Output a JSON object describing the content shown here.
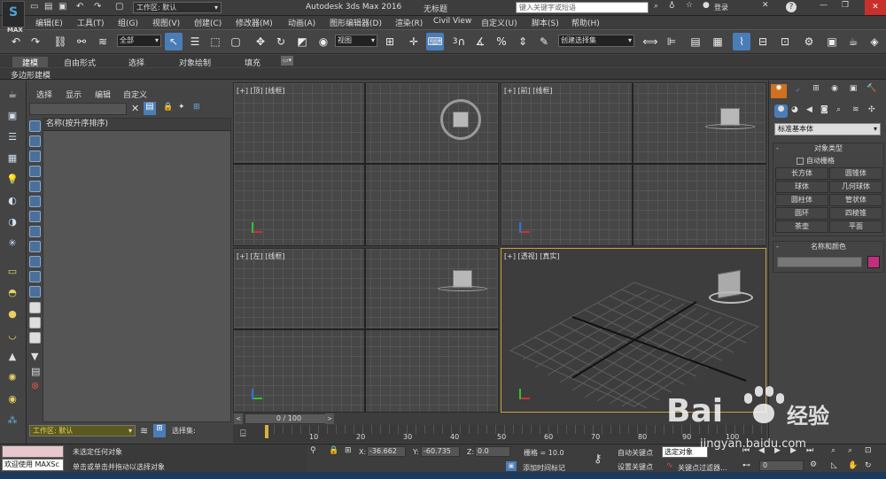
{
  "titlebar": {
    "logo": "MAX",
    "workspace_label": "工作区: 默认",
    "app_title": "Autodesk 3ds Max 2016",
    "doc_title": "无标题",
    "search_placeholder": "键入关键字或短语",
    "login_label": "登录"
  },
  "menubar": {
    "items": [
      "编辑(E)",
      "工具(T)",
      "组(G)",
      "视图(V)",
      "创建(C)",
      "修改器(M)",
      "动画(A)",
      "图形编辑器(D)",
      "渲染(R)",
      "Civil View",
      "自定义(U)",
      "脚本(S)",
      "帮助(H)"
    ]
  },
  "maintoolbar": {
    "selection_filter": "全部",
    "ref_coord": "视图",
    "named_selection": "创建选择集",
    "snap_label": "3"
  },
  "ribbon": {
    "tabs": [
      "建模",
      "自由形式",
      "选择",
      "对象绘制",
      "填充"
    ],
    "sub_label": "多边形建模"
  },
  "scene_explorer": {
    "menu": [
      "选择",
      "显示",
      "编辑",
      "自定义"
    ],
    "column_header": "名称(按升序排序)",
    "workspace_label": "工作区: 默认",
    "selection_set_label": "选择集:"
  },
  "viewports": [
    {
      "label": "[+] [顶] [线框]"
    },
    {
      "label": "[+] [前] [线框]"
    },
    {
      "label": "[+] [左] [线框]"
    },
    {
      "label": "[+] [透视] [真实]"
    }
  ],
  "command_panel": {
    "dropdown": "标准基本体",
    "section_object_type": "对象类型",
    "autogrid": "自动栅格",
    "buttons": [
      "长方体",
      "圆锥体",
      "球体",
      "几何球体",
      "圆柱体",
      "管状体",
      "圆环",
      "四棱锥",
      "茶壶",
      "平面"
    ],
    "section_name_color": "名称和颜色",
    "color_swatch": "#c0307a"
  },
  "timeline": {
    "slider_label": "0 / 100",
    "ticks": [
      "10",
      "20",
      "30",
      "40",
      "50",
      "60",
      "70",
      "80",
      "90",
      "100"
    ]
  },
  "statusbar": {
    "welcome": "欢迎使用 MAXSc",
    "status_line1": "未选定任何对象",
    "status_line2": "单击或单击并拖动以选择对象",
    "x_label": "X:",
    "x_value": "-36.662",
    "y_label": "Y:",
    "y_value": "-60.735",
    "z_label": "Z:",
    "z_value": "0.0",
    "grid_label": "栅格 = 10.0",
    "add_time_tag": "添加时间标记",
    "auto_key": "自动关键点",
    "set_key": "设置关键点",
    "selected_dropdown": "选定对象",
    "key_filters": "关键点过滤器...",
    "frame_value": "0"
  },
  "watermark": {
    "brand": "Bai",
    "brand2": "经验",
    "url": "jingyan.baidu.com"
  },
  "colors": {
    "accent": "#4a7db8",
    "active_viewport_border": "#c9a23b"
  }
}
